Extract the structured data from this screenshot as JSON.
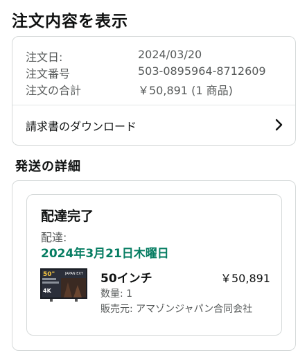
{
  "page": {
    "title": "注文内容を表示"
  },
  "summary": {
    "order_date_label": "注文日:",
    "order_date": "2024/03/20",
    "order_number_label": "注文番号",
    "order_number": "503-0895964-8712609",
    "total_label": "注文の合計",
    "total": "￥50,891 (1 商品)"
  },
  "invoice": {
    "label": "請求書のダウンロード"
  },
  "shipping": {
    "section_title": "発送の詳細",
    "status": "配達完了",
    "delivered_label": "配達:",
    "delivered_date": "2024年3月21日木曜日",
    "item": {
      "name": "50インチ",
      "price": "￥50,891",
      "quantity": "数量: 1",
      "seller": "販売元: アマゾンジャパン合同会社",
      "thumb_text_top": "50\"",
      "thumb_brand": "JAPAN EXT",
      "thumb_badge": "4K"
    }
  },
  "colors": {
    "delivered_green": "#067d62",
    "border": "#d5d9d9",
    "muted_text": "#565959"
  }
}
